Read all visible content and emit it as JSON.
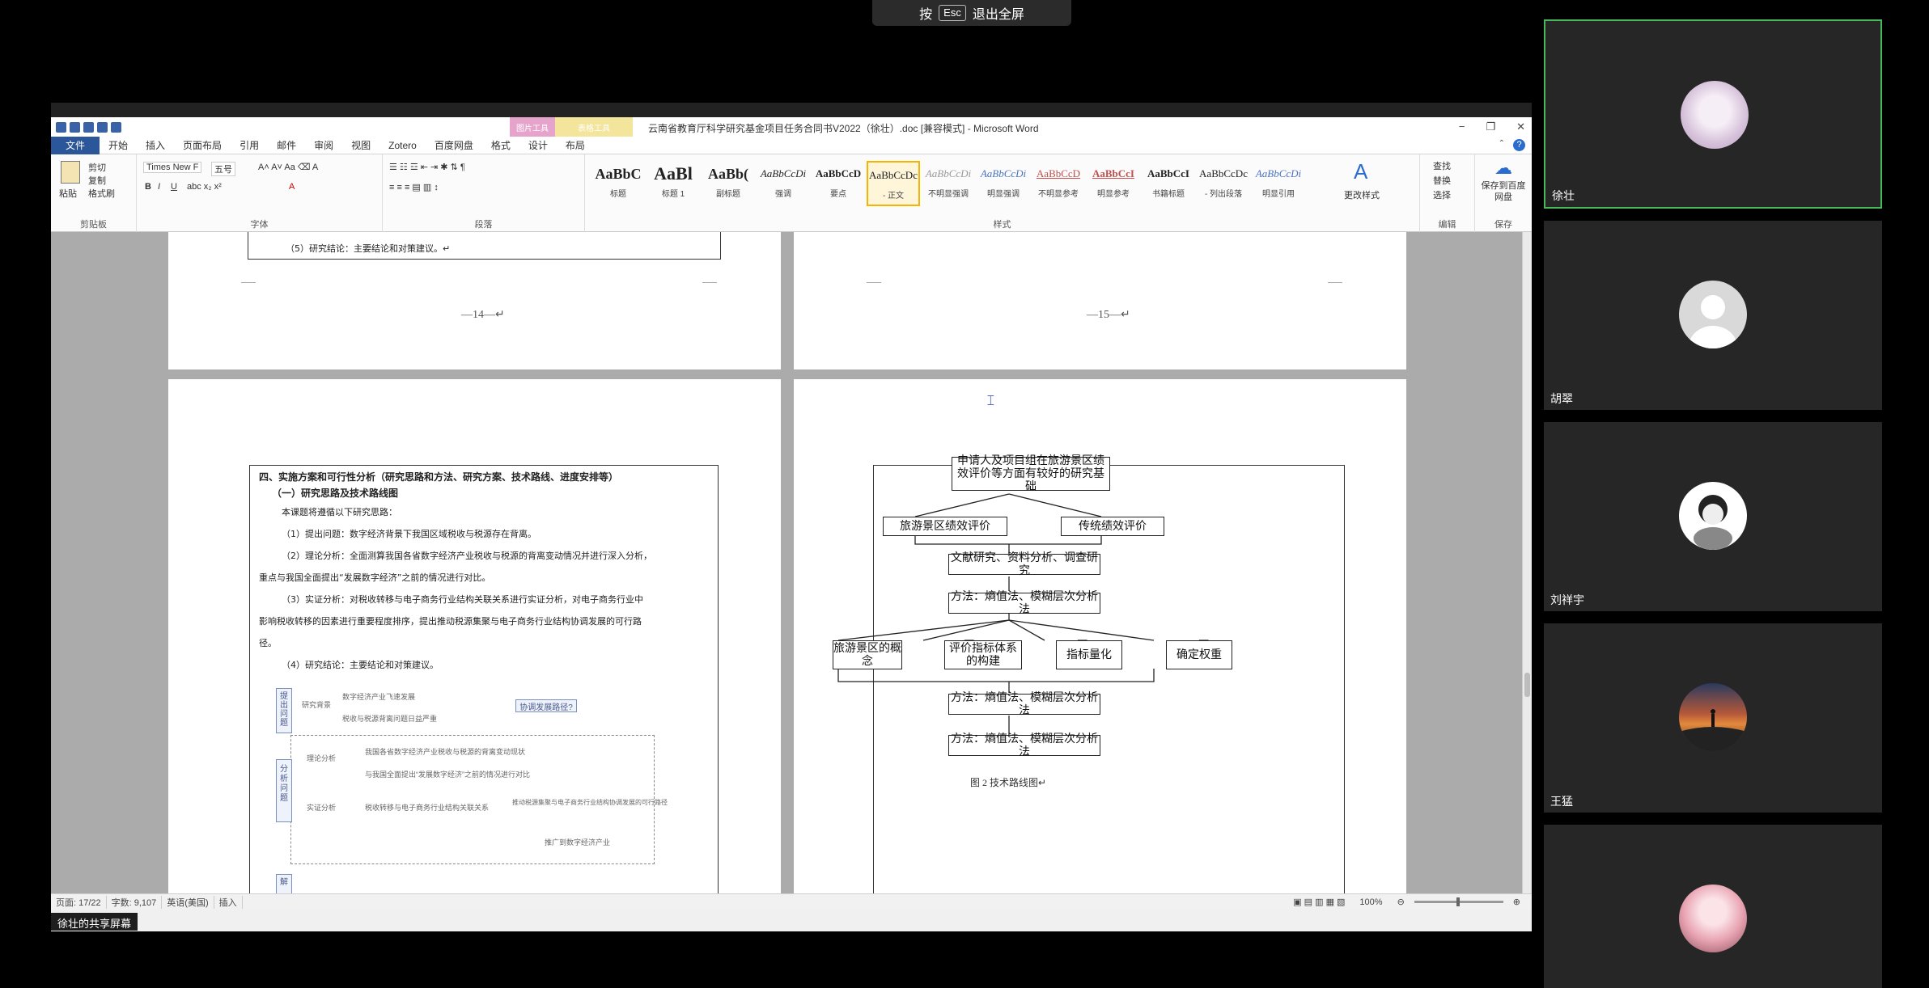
{
  "fullscreen_toast": {
    "prefix": "按",
    "key": "Esc",
    "suffix": "退出全屏"
  },
  "word": {
    "title": "云南省教育厅科学研究基金项目任务合同书V2022（徐壮）.doc [兼容模式] - Microsoft Word",
    "context_tabs": [
      "图片工具",
      "表格工具"
    ],
    "tabs": [
      "文件",
      "开始",
      "插入",
      "页面布局",
      "引用",
      "邮件",
      "审阅",
      "视图",
      "Zotero",
      "百度网盘",
      "格式",
      "设计",
      "布局"
    ],
    "window_controls": [
      "−",
      "❐",
      "✕"
    ],
    "clipboard": {
      "paste": "粘贴",
      "cut": "剪切",
      "copy": "复制",
      "format_painter": "格式刷",
      "label": "剪贴板"
    },
    "font": {
      "name": "Times New F",
      "size": "五号",
      "label": "字体"
    },
    "paragraph": {
      "label": "段落"
    },
    "styles": {
      "label": "样式",
      "items": [
        {
          "preview": "AaBbC",
          "name": "标题"
        },
        {
          "preview": "AaBl",
          "name": "标题 1"
        },
        {
          "preview": "AaBb(",
          "name": "副标题"
        },
        {
          "preview": "AaBbCcDi",
          "name": "强调"
        },
        {
          "preview": "AaBbCcD",
          "name": "要点"
        },
        {
          "preview": "AaBbCcDc",
          "name": "- 正文"
        },
        {
          "preview": "AaBbCcDi",
          "name": "不明显强调"
        },
        {
          "preview": "AaBbCcDi",
          "name": "明显强调"
        },
        {
          "preview": "AaBbCcD",
          "name": "不明显参考"
        },
        {
          "preview": "AaBbCcI",
          "name": "明显参考"
        },
        {
          "preview": "AaBbCcI",
          "name": "书籍标题"
        },
        {
          "preview": "AaBbCcDc",
          "name": "- 列出段落"
        },
        {
          "preview": "AaBbCcDi",
          "name": "明显引用"
        }
      ],
      "change_styles": "更改样式"
    },
    "editing": {
      "find": "查找",
      "replace": "替换",
      "select": "选择",
      "label": "编辑"
    },
    "save": {
      "button": "保存到百度网盘",
      "label": "保存"
    },
    "pages": {
      "p14_last_line": "（5）研究结论：主要结论和对策建议。↵",
      "p14_number": "—14—↵",
      "p15_number": "—15—↵",
      "section_heading": "四、实施方案和可行性分析（研究思路和方法、研究方案、技术路线、进度安排等）",
      "sub_heading": "（一）研究思路及技术路线图",
      "paragraphs": [
        "本课题将遵循以下研究思路：",
        "（1）提出问题：数字经济背景下我国区域税收与税源存在背离。",
        "（2）理论分析：全面测算我国各省数字经济产业税收与税源的背离变动情况并进行深入分析，",
        "重点与我国全面提出“发展数字经济”之前的情况进行对比。",
        "（3）实证分析：对税收转移与电子商务行业结构关联关系进行实证分析，对电子商务行业中",
        "影响税收转移的因素进行重要程度排序，提出推动税源集聚与电子商务行业结构协调发展的可行路",
        "径。",
        "（4）研究结论：主要结论和对策建议。"
      ],
      "mini_diagram": {
        "stage1": "提出问题",
        "stage2": "分析问题",
        "stage3": "解",
        "bg": "研究背景",
        "bg_item1": "数字经济产业飞速发展",
        "bg_item2": "税收与税源背离问题日益严重",
        "tag": "协调发展路径?",
        "theory": "理论分析",
        "theory_item1": "我国各省数字经济产业税收与税源的背离变动现状",
        "theory_item2": "与我国全面提出“发展数字经济”之前的情况进行对比",
        "empirical": "实证分析",
        "empirical_item1": "税收转移与电子商务行业结构关联关系",
        "empirical_item2": "推动税源集聚与电子商务行业结构协调发展的可行路径",
        "item_bottom": "推广到数字经济产业"
      },
      "flowchart": {
        "top": "申请人及项目组在旅游景区绩效评价等方面有较好的研究基础",
        "left": "旅游景区绩效评价",
        "right": "传统绩效评价",
        "research": "文献研究、资料分析、调查研究",
        "method1": "方法：熵值法、模糊层次分析法",
        "step1": "旅游景区的概念",
        "step2": "评价指标体系的构建",
        "step3": "指标量化",
        "step4": "确定权重",
        "method2": "方法：熵值法、模糊层次分析法",
        "method3": "方法：熵值法、模糊层次分析法",
        "caption": "图 2  技术路线图↵"
      }
    },
    "statusbar": {
      "page": "页面: 17/22",
      "words": "字数: 9,107",
      "lang": "英语(美国)",
      "mode": "插入",
      "zoom": "100%"
    }
  },
  "share_label": "徐壮的共享屏幕",
  "participants": [
    {
      "name": "徐壮",
      "active": true
    },
    {
      "name": "胡翠",
      "active": false
    },
    {
      "name": "刘祥宇",
      "active": false
    },
    {
      "name": "王猛",
      "active": false
    },
    {
      "name": "",
      "active": false
    }
  ],
  "colors": {
    "word_blue": "#2b579a",
    "active_border": "#49b85a",
    "tile_bg": "#262626"
  }
}
